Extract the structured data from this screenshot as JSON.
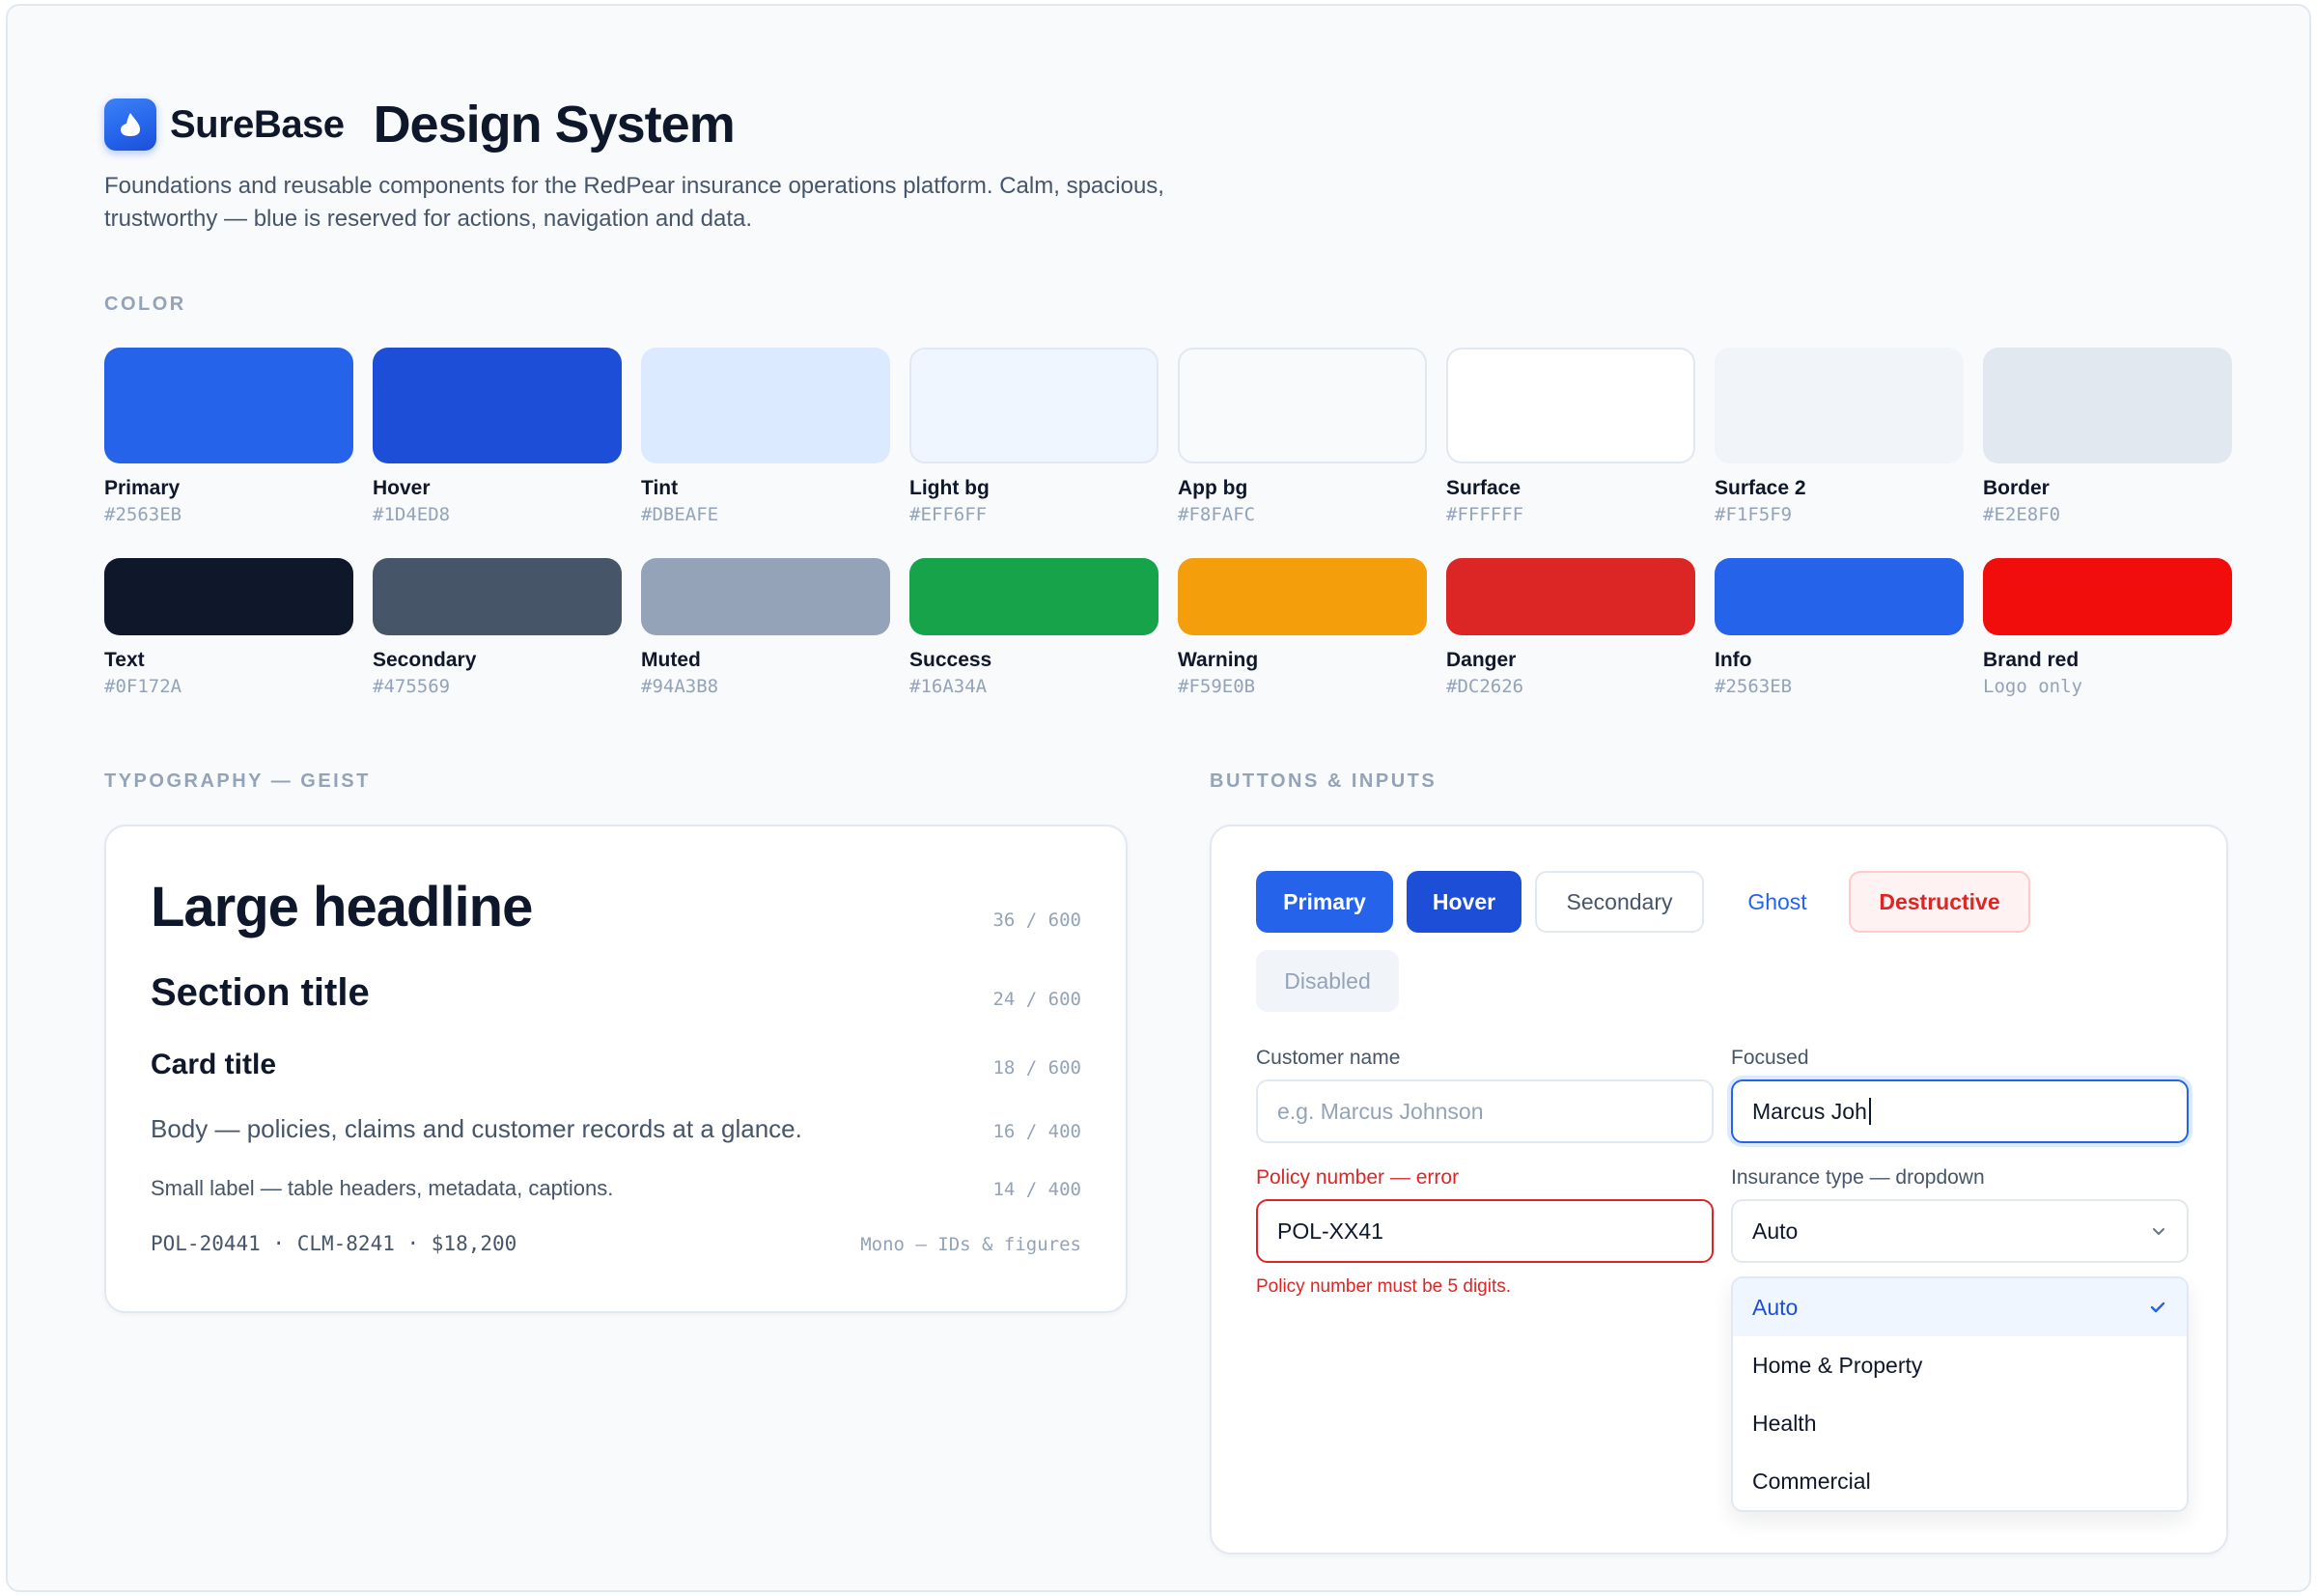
{
  "header": {
    "brand": "SureBase",
    "title": "Design System",
    "description": "Foundations and reusable components for the RedPear insurance operations platform. Calm, spacious, trustworthy — blue is reserved for actions, navigation and data."
  },
  "color": {
    "label": "COLOR",
    "row1": [
      {
        "name": "Primary",
        "hex": "#2563EB",
        "color": "#2563EB"
      },
      {
        "name": "Hover",
        "hex": "#1D4ED8",
        "color": "#1D4ED8"
      },
      {
        "name": "Tint",
        "hex": "#DBEAFE",
        "color": "#DBEAFE"
      },
      {
        "name": "Light bg",
        "hex": "#EFF6FF",
        "color": "#EFF6FF"
      },
      {
        "name": "App bg",
        "hex": "#F8FAFC",
        "color": "#F8FAFC"
      },
      {
        "name": "Surface",
        "hex": "#FFFFFF",
        "color": "#FFFFFF"
      },
      {
        "name": "Surface 2",
        "hex": "#F1F5F9",
        "color": "#F1F5F9"
      },
      {
        "name": "Border",
        "hex": "#E2E8F0",
        "color": "#E2E8F0"
      }
    ],
    "row2": [
      {
        "name": "Text",
        "hex": "#0F172A",
        "color": "#0F172A"
      },
      {
        "name": "Secondary",
        "hex": "#475569",
        "color": "#475569"
      },
      {
        "name": "Muted",
        "hex": "#94A3B8",
        "color": "#94A3B8"
      },
      {
        "name": "Success",
        "hex": "#16A34A",
        "color": "#16A34A"
      },
      {
        "name": "Warning",
        "hex": "#F59E0B",
        "color": "#F59E0B"
      },
      {
        "name": "Danger",
        "hex": "#DC2626",
        "color": "#DC2626"
      },
      {
        "name": "Info",
        "hex": "#2563EB",
        "color": "#2563EB"
      },
      {
        "name": "Brand red",
        "hex": "Logo only",
        "color": "#F20D0D"
      }
    ]
  },
  "typography": {
    "label": "TYPOGRAPHY — GEIST",
    "samples": [
      {
        "text": "Large headline",
        "meta": "36 / 600"
      },
      {
        "text": "Section title",
        "meta": "24 / 600"
      },
      {
        "text": "Card title",
        "meta": "18 / 600"
      },
      {
        "text": "Body — policies, claims and customer records at a glance.",
        "meta": "16 / 400"
      },
      {
        "text": "Small label — table headers, metadata, captions.",
        "meta": "14 / 400"
      },
      {
        "text": "POL-20441 · CLM-8241 · $18,200",
        "meta": "Mono — IDs & figures"
      }
    ]
  },
  "buttons_inputs": {
    "label": "BUTTONS & INPUTS",
    "buttons": {
      "primary": "Primary",
      "hover": "Hover",
      "secondary": "Secondary",
      "ghost": "Ghost",
      "destructive": "Destructive",
      "disabled": "Disabled"
    },
    "customer_name": {
      "label": "Customer name",
      "placeholder": "e.g. Marcus Johnson"
    },
    "focused": {
      "label": "Focused",
      "value": "Marcus Joh"
    },
    "policy_number": {
      "label": "Policy number — error",
      "value": "POL-XX41",
      "error": "Policy number must be 5 digits."
    },
    "insurance_type": {
      "label": "Insurance type — dropdown",
      "value": "Auto",
      "options": [
        "Auto",
        "Home & Property",
        "Health",
        "Commercial"
      ],
      "selected_index": 0
    }
  }
}
